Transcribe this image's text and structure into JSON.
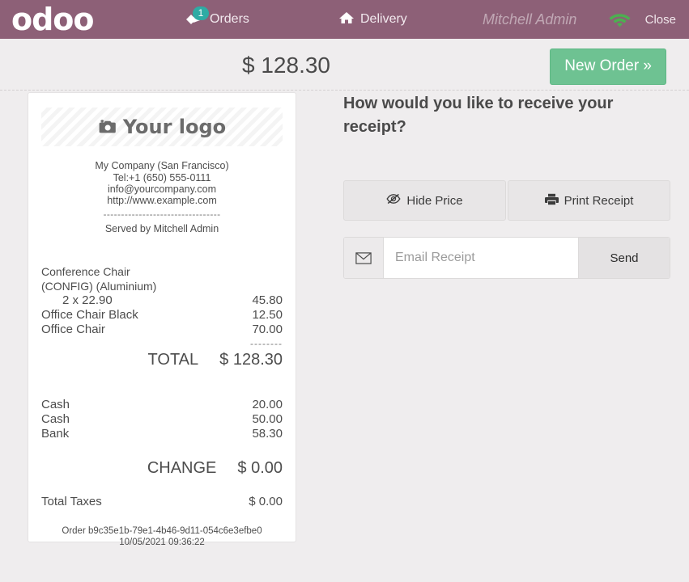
{
  "header": {
    "brand": "odoo",
    "orders_label": "Orders",
    "orders_badge": "1",
    "delivery_label": "Delivery",
    "user": "Mitchell Admin",
    "close_label": "Close",
    "bar_color": "#8d6077",
    "badge_color": "#2eaba4",
    "wifi_color": "#4cb050"
  },
  "totalbar": {
    "amount": "$ 128.30",
    "new_order_label": "New Order »",
    "new_order_color": "#6ec292"
  },
  "receipt": {
    "logo_placeholder": "Your logo",
    "company": "My Company (San Francisco)",
    "phone": "Tel:+1 (650) 555-0111",
    "email": "info@yourcompany.com",
    "website": "http://www.example.com",
    "separator": "---------------------------------",
    "served_by": "Served by Mitchell Admin",
    "lines": [
      {
        "name": "Conference Chair\n(CONFIG) (Aluminium)",
        "qty": "2 x 22.90",
        "amount": "45.80"
      },
      {
        "name": "Office Chair Black",
        "qty": "",
        "amount": "12.50"
      },
      {
        "name": "Office Chair",
        "qty": "",
        "amount": "70.00"
      }
    ],
    "subtotal_dashes": "--------",
    "total_label": "TOTAL",
    "total_amount": "$ 128.30",
    "payments": [
      {
        "method": "Cash",
        "amount": "20.00"
      },
      {
        "method": "Cash",
        "amount": "50.00"
      },
      {
        "method": "Bank",
        "amount": "58.30"
      }
    ],
    "change_label": "CHANGE",
    "change_amount": "$ 0.00",
    "taxes_label": "Total Taxes",
    "taxes_amount": "$ 0.00",
    "order_id": "Order b9c35e1b-79e1-4b46-9d11-054c6e3efbe0",
    "order_datetime": "10/05/2021 09:36:22"
  },
  "right": {
    "question": "How would you like to receive your receipt?",
    "hide_price_label": "Hide Price",
    "print_receipt_label": "Print Receipt",
    "email_placeholder": "Email Receipt",
    "email_value": "",
    "send_label": "Send"
  }
}
